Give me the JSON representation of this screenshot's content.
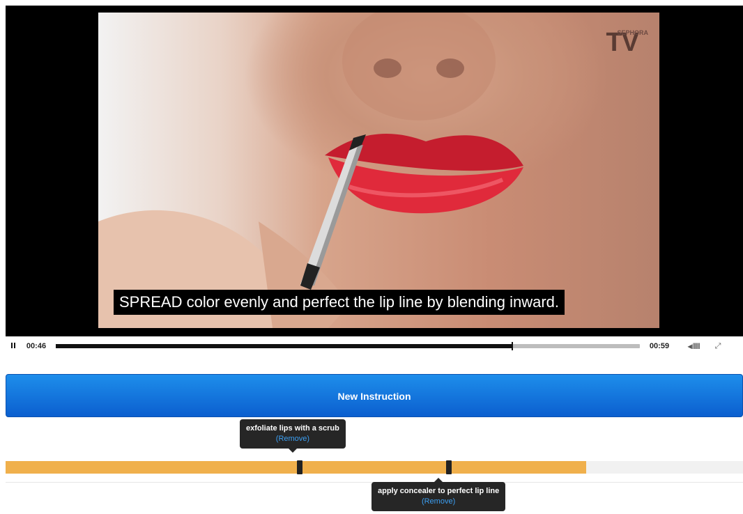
{
  "player": {
    "subtitle": "SPREAD color evenly and perfect the lip line by blending inward.",
    "logo_main": "TV",
    "logo_small": "SEPHORA",
    "current_time": "00:46",
    "total_time": "00:59",
    "progress": 0.78,
    "pause_icon": "pause-icon",
    "volume_icon": "volume-icon",
    "volume_glyph": "◂ıllllll",
    "fullscreen_icon": "fullscreen-icon",
    "fullscreen_glyph": "⤢"
  },
  "new_instruction_label": "New Instruction",
  "timeline": {
    "fill_fraction": 0.787,
    "accent_color": "#f0b04c",
    "markers": [
      {
        "label": "exfoliate lips with a scrub",
        "remove": "(Remove)"
      },
      {
        "label": "apply concealer to perfect lip line",
        "remove": "(Remove)"
      }
    ]
  }
}
